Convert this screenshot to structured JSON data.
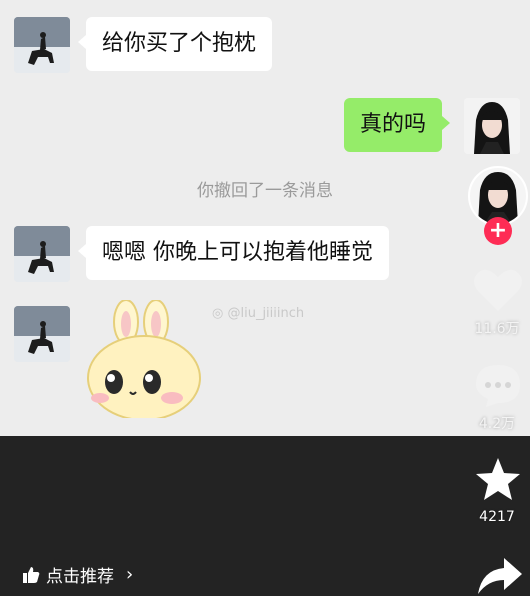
{
  "messages": {
    "msg1": "给你买了个抱枕",
    "msg2": "真的吗",
    "system": "你撤回了一条消息",
    "msg3": "嗯嗯 你晚上可以抱着他睡觉"
  },
  "watermark": "@liu_jiiiinch",
  "side": {
    "likes": "11.6万",
    "comments": "4.2万",
    "favorites": "4217"
  },
  "bottom": {
    "recommend": "点击推荐"
  },
  "colors": {
    "bubble_green": "#95ec69",
    "follow_red": "#fe2c55",
    "chat_bg": "#ededed",
    "bar_bg": "#232323"
  },
  "icons": [
    "heart-icon",
    "comment-icon",
    "star-icon",
    "share-icon",
    "thumbs-up-icon",
    "chevron-right-icon",
    "plus-icon",
    "weibo-icon"
  ]
}
